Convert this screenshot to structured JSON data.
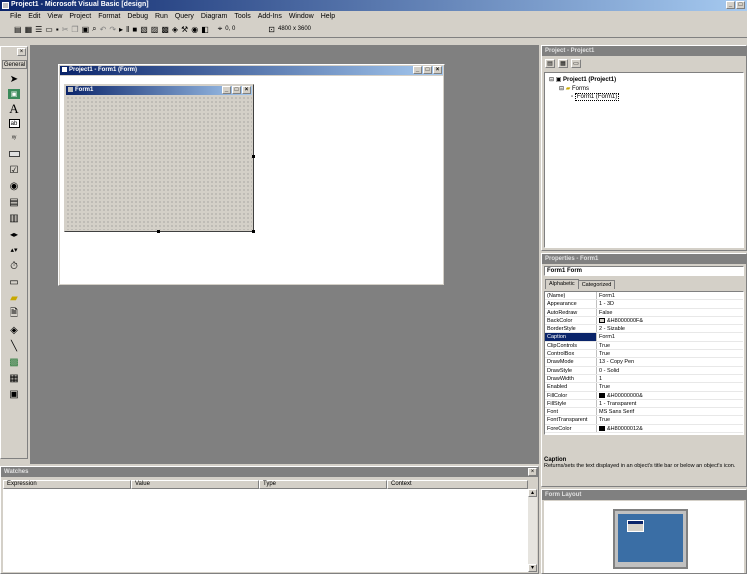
{
  "app": {
    "title": "Project1 - Microsoft Visual Basic [design]",
    "window_controls": [
      "_",
      "□",
      "×"
    ]
  },
  "menu": [
    "File",
    "Edit",
    "View",
    "Project",
    "Format",
    "Debug",
    "Run",
    "Query",
    "Diagram",
    "Tools",
    "Add-Ins",
    "Window",
    "Help"
  ],
  "toolbar": {
    "position_text": "0, 0",
    "size_text": "4800 x 3600"
  },
  "toolbox": {
    "title": "General",
    "close": "×",
    "tools": [
      "pointer-icon",
      "picturebox-icon",
      "label-icon",
      "textbox-icon",
      "frame-icon",
      "commandbutton-icon",
      "checkbox-icon",
      "optionbutton-icon",
      "combobox-icon",
      "listbox-icon",
      "hscrollbar-icon",
      "vscrollbar-icon",
      "timer-icon",
      "drivelistbox-icon",
      "dirlistbox-icon",
      "filelistbox-icon",
      "shape-icon",
      "line-icon",
      "image-icon",
      "data-icon",
      "ole-icon"
    ]
  },
  "designer": {
    "window_title": "Project1 - Form1 (Form)",
    "form_caption": "Form1"
  },
  "project": {
    "title": "Project - Project1",
    "tree": [
      "Project1 (Project1)",
      "Forms",
      "Form1 (Form1)"
    ]
  },
  "properties": {
    "title": "Properties - Form1",
    "object": "Form1 Form",
    "tabs": [
      "Alphabetic",
      "Categorized"
    ],
    "rows": [
      [
        "(Name)",
        "Form1"
      ],
      [
        "Appearance",
        "1 - 3D"
      ],
      [
        "AutoRedraw",
        "False"
      ],
      [
        "BackColor",
        "&H8000000F&"
      ],
      [
        "BorderStyle",
        "2 - Sizable"
      ],
      [
        "Caption",
        "Form1"
      ],
      [
        "ClipControls",
        "True"
      ],
      [
        "ControlBox",
        "True"
      ],
      [
        "DrawMode",
        "13 - Copy Pen"
      ],
      [
        "DrawStyle",
        "0 - Solid"
      ],
      [
        "DrawWidth",
        "1"
      ],
      [
        "Enabled",
        "True"
      ],
      [
        "FillColor",
        "&H00000000&"
      ],
      [
        "FillStyle",
        "1 - Transparent"
      ],
      [
        "Font",
        "MS Sans Serif"
      ],
      [
        "FontTransparent",
        "True"
      ],
      [
        "ForeColor",
        "&H80000012&"
      ]
    ],
    "selected_index": 5,
    "desc_title": "Caption",
    "desc_text": "Returns/sets the text displayed in an object's title bar or below an object's icon."
  },
  "watches": {
    "title": "Watches",
    "columns": [
      "Expression",
      "Value",
      "Type",
      "Context"
    ],
    "close": "×"
  },
  "form_layout": {
    "title": "Form Layout"
  },
  "colors": {
    "title_start": "#0a246a",
    "title_end": "#a6caf0",
    "workspace": "#808080",
    "selection": "#0a246a",
    "monitor_screen": "#3a6ea5"
  }
}
